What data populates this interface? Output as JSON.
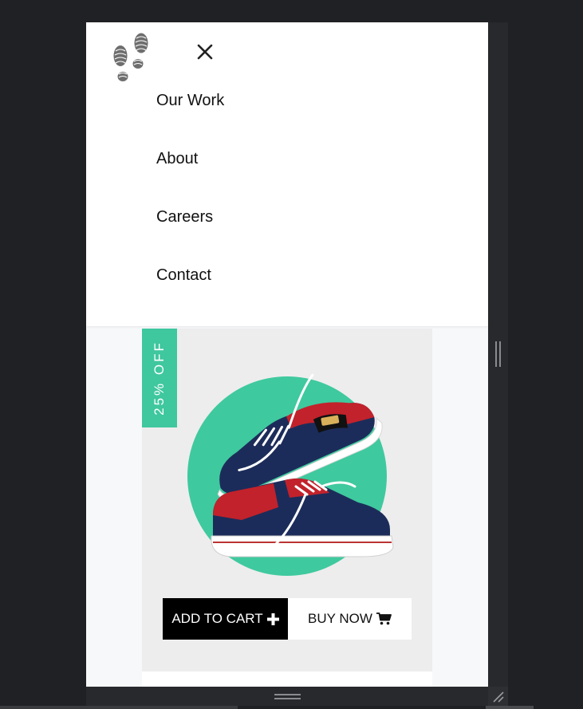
{
  "nav": {
    "logo_icon": "footprints-icon",
    "close_icon": "close-icon",
    "items": [
      {
        "label": "Our Work"
      },
      {
        "label": "About"
      },
      {
        "label": "Careers"
      },
      {
        "label": "Contact"
      }
    ]
  },
  "product": {
    "badge": "25% OFF",
    "image_icon": "sneakers-image",
    "add_to_cart_label": "ADD TO CART",
    "add_icon": "plus-icon",
    "buy_now_label": "BUY NOW",
    "cart_icon": "cart-icon"
  },
  "colors": {
    "accent": "#3fc79e",
    "frame": "#202124",
    "card": "#ededed"
  }
}
